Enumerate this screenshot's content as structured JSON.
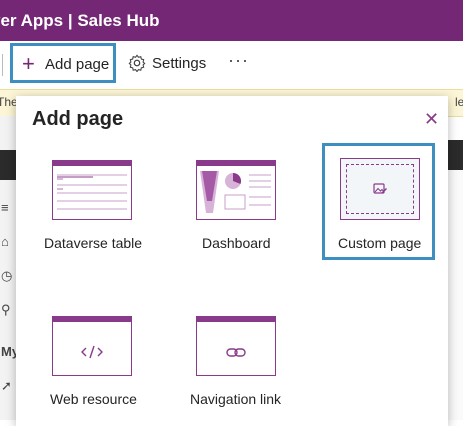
{
  "app": {
    "title": "ver Apps  |  Sales Hub"
  },
  "commandbar": {
    "add_page_label": "Add page",
    "settings_label": "Settings",
    "more_label": "···"
  },
  "banner": {
    "text_left": "The",
    "text_right": "le"
  },
  "leftnav": {
    "section_label": "My"
  },
  "dialog": {
    "title": "Add page",
    "close_icon": "close-icon",
    "options": [
      {
        "label": "Dataverse table",
        "icon": "table-preview-icon"
      },
      {
        "label": "Dashboard",
        "icon": "dashboard-preview-icon"
      },
      {
        "label": "Custom page",
        "icon": "custom-page-icon",
        "selected": true
      },
      {
        "label": "Web resource",
        "icon": "code-icon"
      },
      {
        "label": "Navigation link",
        "icon": "link-icon"
      }
    ]
  },
  "colors": {
    "brand": "#742774",
    "accent": "#8a3a8a",
    "highlight": "#3d8fc1"
  }
}
